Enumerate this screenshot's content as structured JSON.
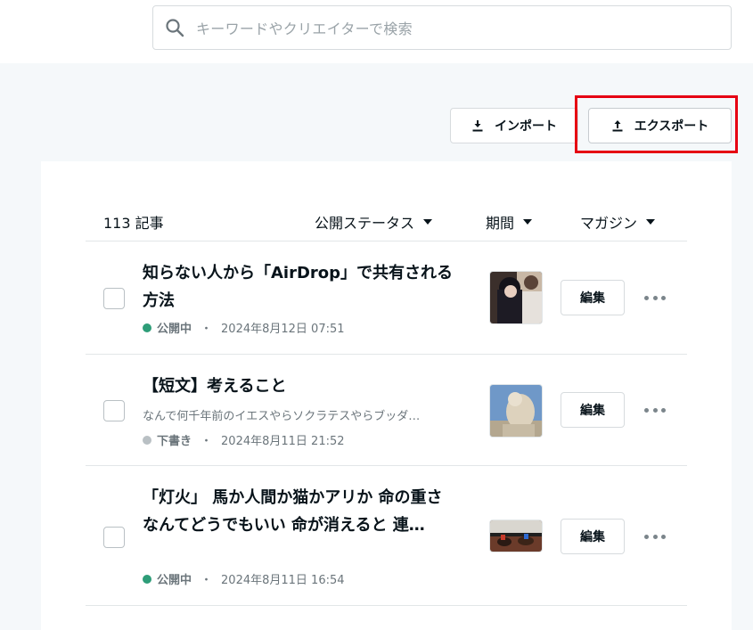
{
  "search": {
    "placeholder": "キーワードやクリエイターで検索"
  },
  "toolbar": {
    "import_label": "インポート",
    "export_label": "エクスポート"
  },
  "list": {
    "count_label": "113 記事",
    "filters": {
      "status": "公開ステータス",
      "period": "期間",
      "magazine": "マガジン"
    },
    "edit_label": "編集",
    "articles": [
      {
        "title": "知らない人から「AirDrop」で共有される方法",
        "status": "公開中",
        "status_color": "#2e9d78",
        "date": "2024年8月12日 07:51"
      },
      {
        "title": "【短文】考えること",
        "excerpt": "なんで何千年前のイエスやらソクラテスやらブッダ…",
        "status": "下書き",
        "status_color": "#b9c0c4",
        "date": "2024年8月11日 21:52"
      },
      {
        "title": "「灯火」 馬か人間か猫かアリか 命の重さなんてどうでもいい 命が消えると 連…",
        "status": "公開中",
        "status_color": "#2e9d78",
        "date": "2024年8月11日 16:54"
      }
    ]
  },
  "separator": "・",
  "colors": {
    "highlight": "#e60012",
    "published": "#2e9d78",
    "draft": "#b9c0c4"
  }
}
